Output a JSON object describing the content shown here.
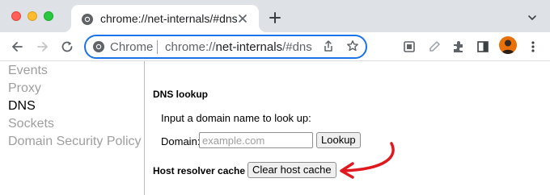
{
  "browser": {
    "tab": {
      "title": "chrome://net-internals/#dns"
    },
    "omnibox": {
      "chip": "Chrome",
      "url_prefix": "chrome://",
      "url_host": "net-internals",
      "url_suffix": "/#dns"
    },
    "colors": {
      "accent": "#1a73e8",
      "tabstrip": "#dee1e6"
    },
    "icons": [
      "back-icon",
      "forward-icon",
      "reload-icon",
      "share-icon",
      "star-icon",
      "tab-search-icon",
      "eyedropper-icon",
      "extensions-icon",
      "side-panel-icon",
      "menu-icon"
    ]
  },
  "sidebar": {
    "items": [
      {
        "label": "Events",
        "active": false
      },
      {
        "label": "Proxy",
        "active": false
      },
      {
        "label": "DNS",
        "active": true
      },
      {
        "label": "Sockets",
        "active": false
      },
      {
        "label": "Domain Security Policy",
        "active": false
      }
    ]
  },
  "dns": {
    "title": "DNS lookup",
    "instruction": "Input a domain name to look up:",
    "domain_label": "Domain:",
    "domain_placeholder": "example.com",
    "domain_value": "",
    "lookup_button": "Lookup",
    "cache_label": "Host resolver cache",
    "clear_button": "Clear host cache",
    "annotation_color": "#e0191e"
  }
}
